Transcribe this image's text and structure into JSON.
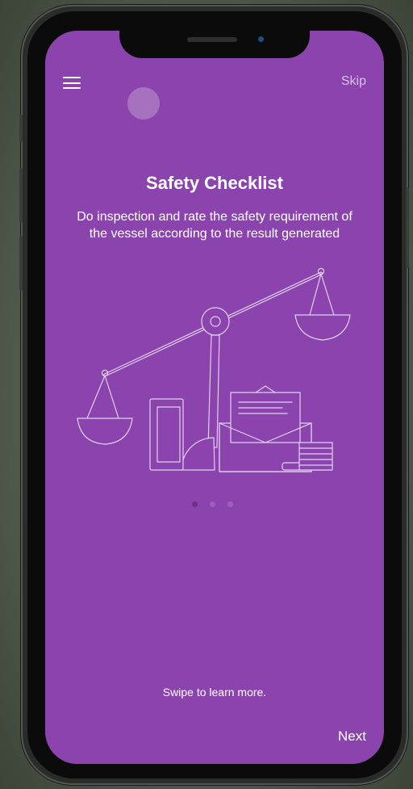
{
  "header": {
    "menu_icon": "hamburger-menu-icon",
    "skip_label": "Skip"
  },
  "onboarding": {
    "title": "Safety Checklist",
    "description": "Do inspection and rate the safety requirement of the vessel according to the result generated",
    "illustration": "balance-scale-documents-illustration",
    "pagination": {
      "total": 3,
      "active_index": 0
    }
  },
  "footer": {
    "hint": "Swipe to learn more.",
    "next_label": "Next"
  },
  "colors": {
    "screen_background": "#8b44ae",
    "illustration_stroke": "#e3d0ee",
    "dot_active": "#6a3383",
    "dot_inactive": "#9a5fb8"
  }
}
